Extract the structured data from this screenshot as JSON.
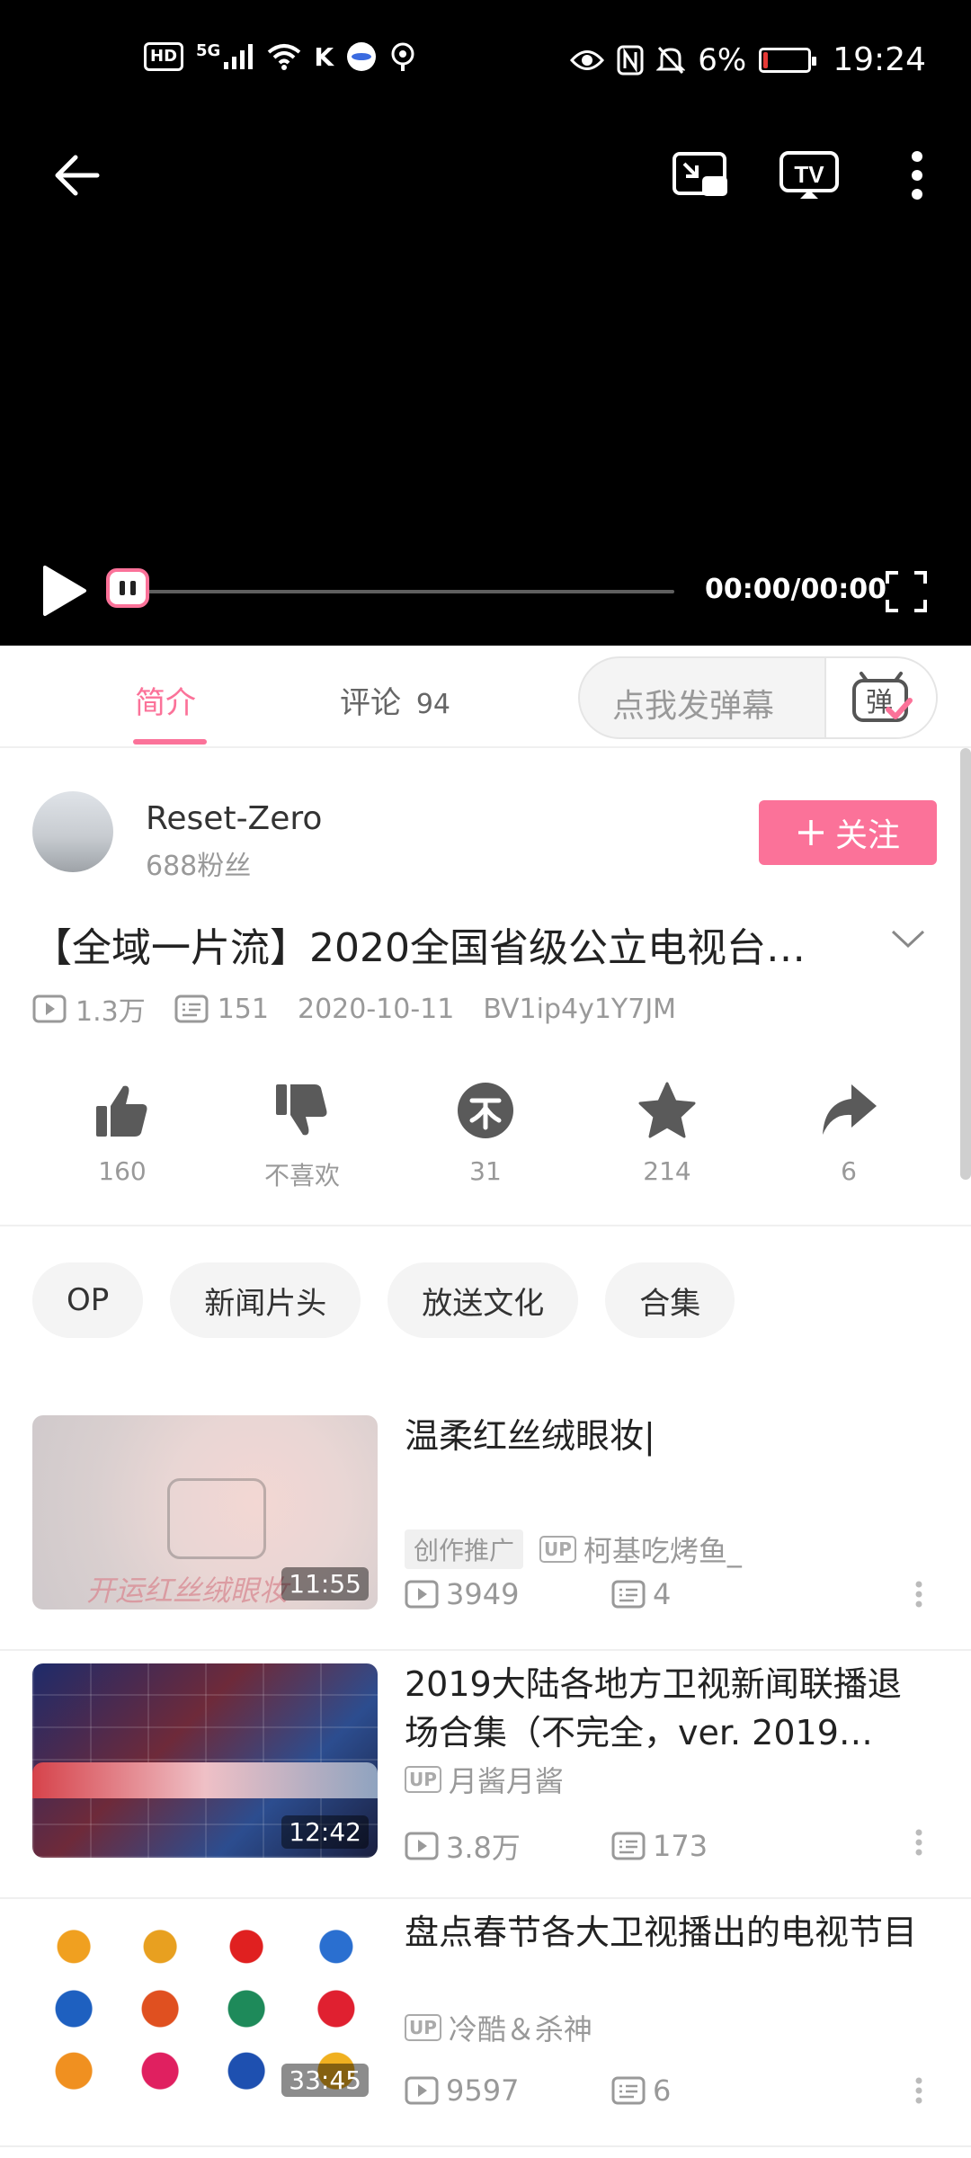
{
  "status_bar": {
    "hd": "HD",
    "network": "5G",
    "battery_percent": "6%",
    "time": "19:24",
    "icons": [
      "signal-icon",
      "wifi-icon",
      "k-app-icon",
      "browser-icon",
      "hotspot-icon",
      "eye-icon",
      "nfc-icon",
      "mute-icon",
      "battery-icon"
    ]
  },
  "player": {
    "time_display": "00:00/00:00",
    "progress": 0,
    "icons": [
      "back-arrow-icon",
      "mini-window-icon",
      "tv-cast-icon",
      "more-vertical-icon",
      "play-icon",
      "fullscreen-icon"
    ]
  },
  "tabs": {
    "intro": "简介",
    "comments_label": "评论",
    "comments_count": "94",
    "danmaku_placeholder": "点我发弹幕",
    "danmaku_toggle": "弹"
  },
  "uploader": {
    "name": "Reset-Zero",
    "fans": "688粉丝",
    "follow_label": "关注"
  },
  "video": {
    "title": "【全域一片流】2020全国省级公立电视台…",
    "views": "1.3万",
    "danmaku": "151",
    "date": "2020-10-11",
    "bvid": "BV1ip4y1Y7JM"
  },
  "actions": [
    {
      "icon": "thumbs-up-icon",
      "label": "160"
    },
    {
      "icon": "thumbs-down-icon",
      "label": "不喜欢"
    },
    {
      "icon": "coin-icon",
      "label": "31"
    },
    {
      "icon": "star-icon",
      "label": "214"
    },
    {
      "icon": "share-icon",
      "label": "6"
    }
  ],
  "tags": [
    "OP",
    "新闻片头",
    "放送文化",
    "合集"
  ],
  "related": [
    {
      "title": "温柔红丝绒眼妆|",
      "promo": "创作推广",
      "uploader": "柯基吃烤鱼_",
      "views": "3949",
      "danmaku": "4",
      "duration": "11:55",
      "thumb_caption": "开运红丝绒眼妆"
    },
    {
      "title": "2019大陆各地方卫视新闻联播退场合集（不完全，ver. 2019…",
      "uploader": "月酱月酱",
      "views": "3.8万",
      "danmaku": "173",
      "duration": "12:42"
    },
    {
      "title": "盘点春节各大卫视播出的电视节目",
      "uploader": "冷酷＆杀神",
      "views": "9597",
      "danmaku": "6",
      "duration": "33:45"
    }
  ],
  "colors": {
    "accent": "#fb7299",
    "player_bg": "#000000",
    "text_secondary": "#999999"
  }
}
